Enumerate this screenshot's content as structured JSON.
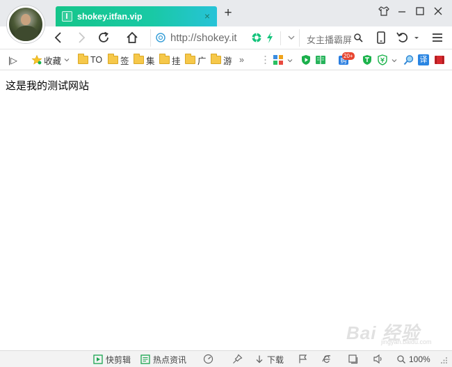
{
  "tab": {
    "title": "shokey.itfan.vip",
    "close": "×",
    "new_tab": "+"
  },
  "window": {
    "skin": "skin",
    "minimize": "—",
    "maximize": "☐",
    "close": "✕"
  },
  "address": {
    "url": "http://shokey.it"
  },
  "search": {
    "text": "女主播霸屏"
  },
  "bookmarks": {
    "sidebar_toggle": "|▷",
    "favorites_label": "收藏",
    "folders": [
      "TO",
      "签",
      "集",
      "挂",
      "广",
      "游"
    ],
    "more": "»",
    "badge_count": "20+",
    "translate_label": "译"
  },
  "page": {
    "text": "这是我的测试网站"
  },
  "statusbar": {
    "quick_edit": "快剪辑",
    "hot_news": "热点资讯",
    "download": "下载",
    "zoom": "100%"
  },
  "watermark": {
    "main": "Bai 经验",
    "sub": "jingyan.baidu.com"
  },
  "colors": {
    "tab_gradient_start": "#15c58a",
    "tab_gradient_end": "#27c3d8",
    "accent_green": "#13c37b",
    "folder_yellow": "#f6c84a"
  }
}
